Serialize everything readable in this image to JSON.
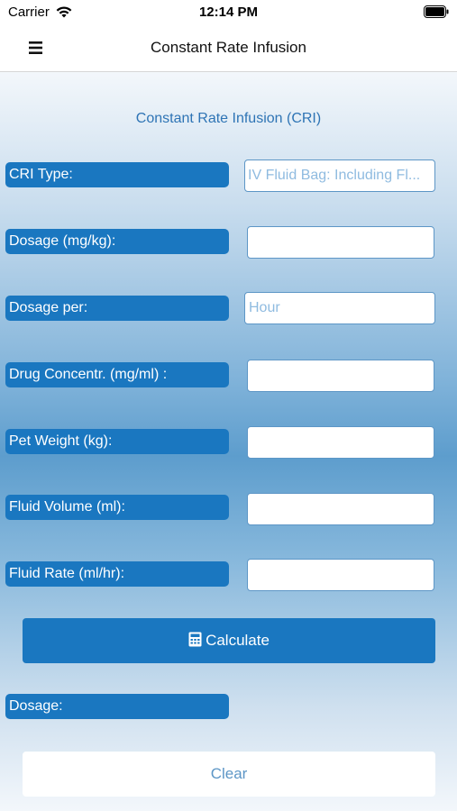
{
  "status_bar": {
    "carrier": "Carrier",
    "time": "12:14 PM"
  },
  "nav": {
    "title": "Constant Rate Infusion",
    "menu_icon": "hamburger-icon"
  },
  "form": {
    "section_title": "Constant Rate Infusion (CRI)",
    "cri_type": {
      "label": "CRI Type:",
      "value": "IV Fluid Bag: Including Fl..."
    },
    "dosage": {
      "label": "Dosage (mg/kg):",
      "value": ""
    },
    "dosage_per": {
      "label": "Dosage per:",
      "placeholder": "Hour"
    },
    "drug_concentration": {
      "label": "Drug Concentr. (mg/ml) :",
      "value": ""
    },
    "pet_weight": {
      "label": "Pet Weight (kg):",
      "value": ""
    },
    "fluid_volume": {
      "label": "Fluid Volume (ml):",
      "value": ""
    },
    "fluid_rate": {
      "label": "Fluid Rate (ml/hr):",
      "value": ""
    },
    "calculate_label": "Calculate",
    "calculate_icon": "calculator-icon",
    "result_label": "Dosage:",
    "clear_label": "Clear"
  },
  "colors": {
    "accent": "#1a77c0",
    "field_border": "#5d96c6",
    "placeholder": "#8fbbe0"
  }
}
